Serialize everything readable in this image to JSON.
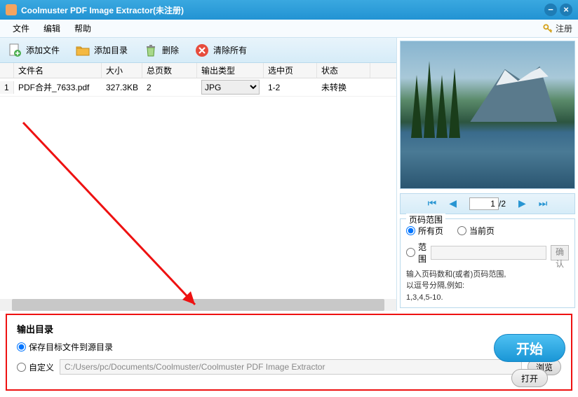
{
  "titlebar": {
    "title": "Coolmuster PDF Image Extractor(未注册)"
  },
  "menu": {
    "file": "文件",
    "edit": "编辑",
    "help": "帮助",
    "register": "注册"
  },
  "toolbar": {
    "add_file": "添加文件",
    "add_folder": "添加目录",
    "delete": "删除",
    "clear_all": "清除所有"
  },
  "table": {
    "headers": {
      "name": "文件名",
      "size": "大小",
      "pages": "总页数",
      "type": "输出类型",
      "selected": "选中页",
      "status": "状态"
    },
    "rows": [
      {
        "num": "1",
        "name": "PDF合并_7633.pdf",
        "size": "327.3KB",
        "pages": "2",
        "type": "JPG",
        "selected": "1-2",
        "status": "未转换"
      }
    ]
  },
  "pager": {
    "current": "1",
    "total": "/2"
  },
  "range": {
    "legend": "页码范围",
    "all": "所有页",
    "current": "当前页",
    "custom": "范围",
    "confirm": "确认",
    "hint1": "输入页码数和(或者)页码范围,",
    "hint2": "以逗号分隔,例如:",
    "hint3": "1,3,4,5-10."
  },
  "output": {
    "title": "输出目录",
    "save_source": "保存目标文件到源目录",
    "custom": "自定义",
    "path": "C:/Users/pc/Documents/Coolmuster/Coolmuster PDF Image Extractor",
    "browse": "浏览"
  },
  "buttons": {
    "start": "开始",
    "open": "打开"
  }
}
